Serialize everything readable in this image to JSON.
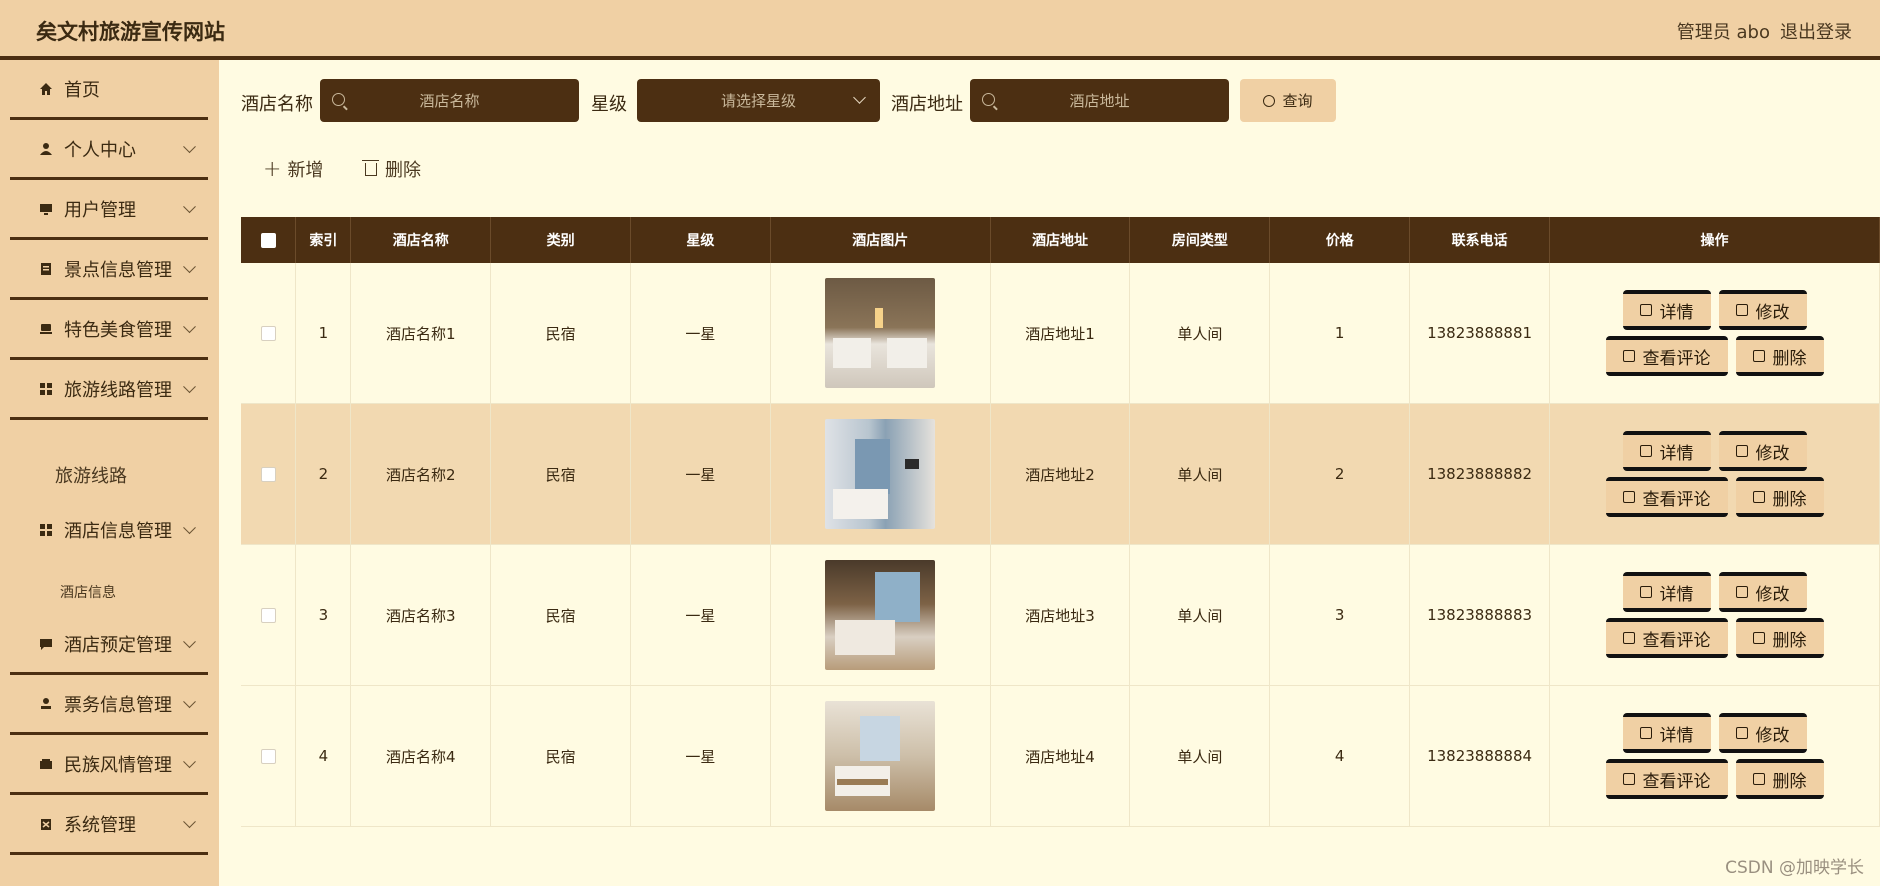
{
  "header": {
    "title": "矣文村旅游宣传网站",
    "admin": "管理员 abo",
    "logout": "退出登录"
  },
  "sidebar": {
    "items": [
      {
        "label": "首页"
      },
      {
        "label": "个人中心"
      },
      {
        "label": "用户管理"
      },
      {
        "label": "景点信息管理"
      },
      {
        "label": "特色美食管理"
      },
      {
        "label": "旅游线路管理"
      },
      {
        "label": "旅游线路"
      },
      {
        "label": "酒店信息管理"
      },
      {
        "label": "酒店信息"
      },
      {
        "label": "酒店预定管理"
      },
      {
        "label": "票务信息管理"
      },
      {
        "label": "民族风情管理"
      },
      {
        "label": "系统管理"
      }
    ]
  },
  "search": {
    "name_label": "酒店名称",
    "name_placeholder": "酒店名称",
    "star_label": "星级",
    "star_placeholder": "请选择星级",
    "address_label": "酒店地址",
    "address_placeholder": "酒店地址",
    "query_button": "查询"
  },
  "actions": {
    "add": "新增",
    "delete": "删除"
  },
  "table": {
    "columns": [
      "索引",
      "酒店名称",
      "类别",
      "星级",
      "酒店图片",
      "酒店地址",
      "房间类型",
      "价格",
      "联系电话",
      "操作"
    ],
    "rows": [
      {
        "index": "1",
        "name": "酒店名称1",
        "category": "民宿",
        "star": "一星",
        "address": "酒店地址1",
        "room": "单人间",
        "price": "1",
        "phone": "13823888881"
      },
      {
        "index": "2",
        "name": "酒店名称2",
        "category": "民宿",
        "star": "一星",
        "address": "酒店地址2",
        "room": "单人间",
        "price": "2",
        "phone": "13823888882"
      },
      {
        "index": "3",
        "name": "酒店名称3",
        "category": "民宿",
        "star": "一星",
        "address": "酒店地址3",
        "room": "单人间",
        "price": "3",
        "phone": "13823888883"
      },
      {
        "index": "4",
        "name": "酒店名称4",
        "category": "民宿",
        "star": "一星",
        "address": "酒店地址4",
        "room": "单人间",
        "price": "4",
        "phone": "13823888884"
      }
    ],
    "op_labels": {
      "detail": "详情",
      "edit": "修改",
      "comments": "查看评论",
      "delete": "删除"
    }
  },
  "watermark": "CSDN @加映学长",
  "colors": {
    "primary_dark": "#4c2f12",
    "accent_tan": "#f0d0a4",
    "page_bg": "#fffbe2",
    "row_alt": "#f2d9b1"
  }
}
